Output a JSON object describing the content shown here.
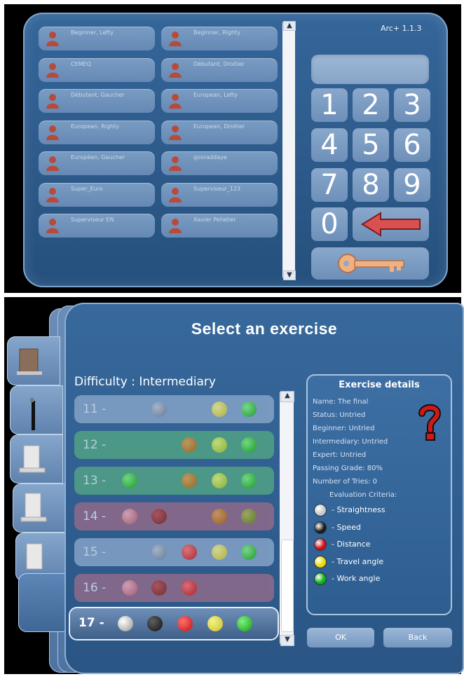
{
  "login": {
    "version": "Arc+ 1.1.3",
    "users": [
      "Beginner, Lefty",
      "Beginner, Righty",
      "CEMEQ",
      "Débutant, Droitier",
      "Débutant, Gaucher",
      "European, Lefty",
      "European, Righty",
      "European, Droitier",
      "Européen, Gaucher",
      "gooraddaye",
      "Super_Euro",
      "Superviseur_123",
      "Superviseur EN",
      "Xavier Pelletier"
    ],
    "keypad": [
      "1",
      "2",
      "3",
      "4",
      "5",
      "6",
      "7",
      "8",
      "9",
      "0"
    ],
    "icons": {
      "user": "person-icon",
      "backspace": "left-arrow-icon",
      "login": "key-icon"
    }
  },
  "exercise": {
    "title": "Select an exercise",
    "difficulty_label": "Difficulty : Intermediary",
    "rows": [
      {
        "num": "11 -",
        "color": "#7f9ec4",
        "balls": [
          "",
          "gray",
          "",
          "yellow",
          "green"
        ]
      },
      {
        "num": "12 -",
        "color": "#4f9e86",
        "balls": [
          "",
          "",
          "orange",
          "lime",
          "green"
        ]
      },
      {
        "num": "13 -",
        "color": "#4f9e86",
        "balls": [
          "green",
          "",
          "orange",
          "lime",
          "green"
        ]
      },
      {
        "num": "14 -",
        "color": "#8a6a8a",
        "balls": [
          "pink",
          "darkred",
          "",
          "orange",
          "olive"
        ]
      },
      {
        "num": "15 -",
        "color": "#7f9ec4",
        "balls": [
          "",
          "gray",
          "red",
          "yellow",
          "green"
        ]
      },
      {
        "num": "16 -",
        "color": "#8a6a8a",
        "balls": [
          "pink",
          "darkred",
          "red",
          "",
          ""
        ]
      },
      {
        "num": "17 -",
        "color": "#4a6890",
        "balls": [
          "white",
          "black",
          "red",
          "yellow",
          "green"
        ],
        "selected": true
      }
    ],
    "details": {
      "heading": "Exercise details",
      "lines": [
        "Name: The final",
        "Status: Untried",
        "Beginner: Untried",
        "Intermediary: Untried",
        "Expert: Untried",
        "Passing Grade: 80%",
        "Number of Tries: 0",
        "Evaluation Criteria:"
      ],
      "criteria": [
        {
          "label": "- Straightness",
          "color": "#c8c8c8"
        },
        {
          "label": "- Speed",
          "color": "#1a1a1a"
        },
        {
          "label": "- Distance",
          "color": "#d01010"
        },
        {
          "label": "- Travel angle",
          "color": "#e8d800"
        },
        {
          "label": "- Work angle",
          "color": "#10b010"
        }
      ],
      "icon": "question-mark-icon"
    },
    "ok_label": "OK",
    "back_label": "Back"
  },
  "colors": {
    "panel": "#2f5d8e",
    "accent": "#d04040"
  }
}
